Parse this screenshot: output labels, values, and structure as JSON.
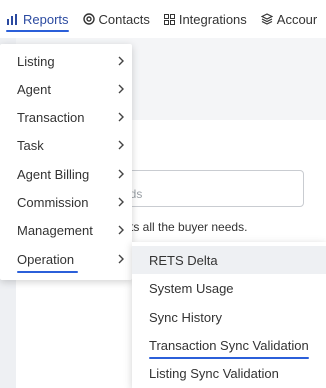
{
  "nav": {
    "reports": "Reports",
    "contacts": "Contacts",
    "integrations": "Integrations",
    "accounts": "Accour"
  },
  "page": {
    "heading_fragment": "s",
    "input_placeholder_fragment": "eds",
    "helper_fragment": "ts all the buyer needs."
  },
  "menu": {
    "items": [
      {
        "label": "Listing"
      },
      {
        "label": "Agent"
      },
      {
        "label": "Transaction"
      },
      {
        "label": "Task"
      },
      {
        "label": "Agent Billing"
      },
      {
        "label": "Commission"
      },
      {
        "label": "Management"
      },
      {
        "label": "Operation"
      }
    ]
  },
  "submenu": {
    "items": [
      {
        "label": "RETS Delta"
      },
      {
        "label": "System Usage"
      },
      {
        "label": "Sync History"
      },
      {
        "label": "Transaction Sync Validation"
      },
      {
        "label": "Listing Sync Validation"
      }
    ]
  },
  "colors": {
    "accent": "#2b5fd9",
    "active_text": "#2b4aa0",
    "hover_bg": "#eef0f3"
  }
}
